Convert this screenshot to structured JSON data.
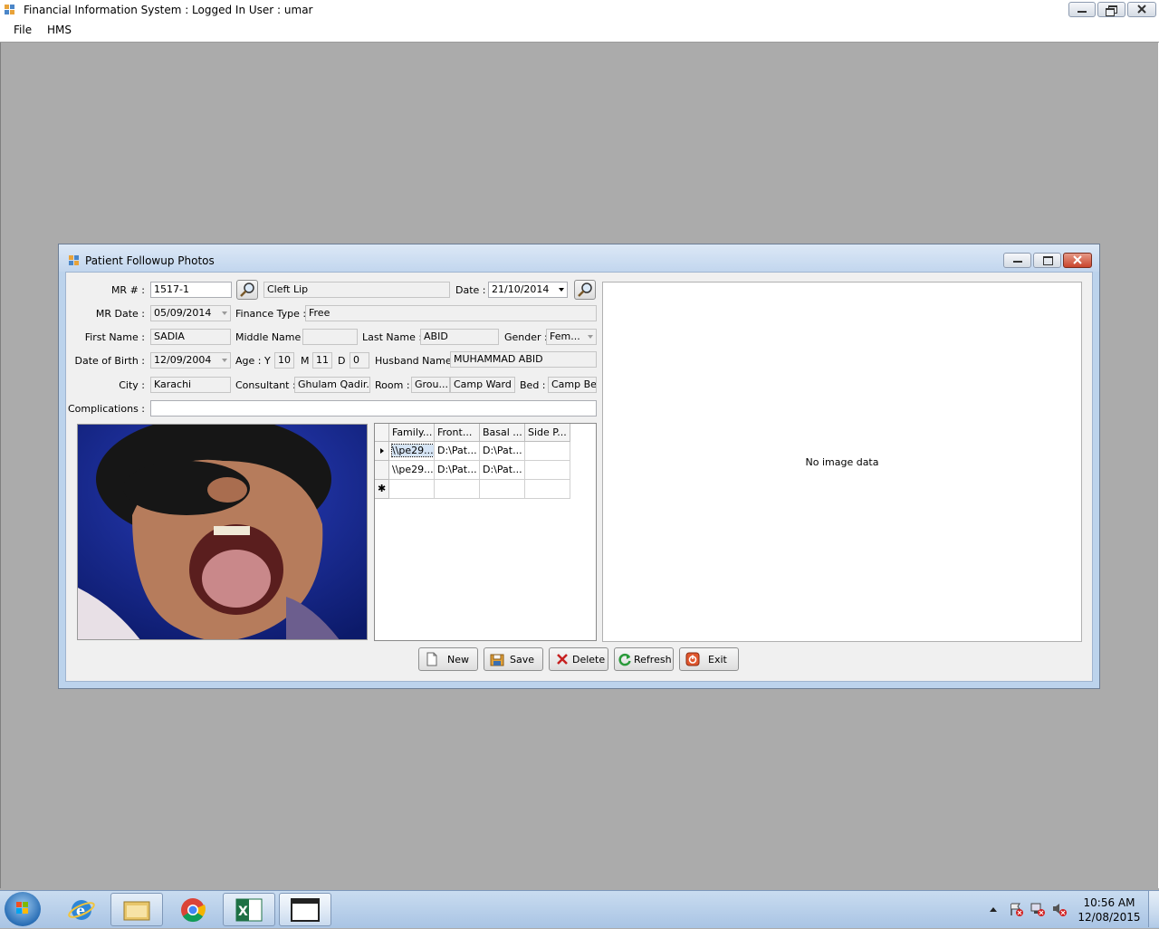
{
  "app": {
    "title": "Financial Information System : Logged In User : umar",
    "menu": [
      "File",
      "HMS"
    ]
  },
  "dialog": {
    "title": "Patient Followup Photos",
    "labels": {
      "mr_no": "MR # :",
      "date": "Date :",
      "mr_date": "MR Date :",
      "finance_type": "Finance Type :",
      "first_name": "First Name :",
      "middle_name": "Middle Name :",
      "last_name": "Last Name :",
      "gender": "Gender :",
      "dob": "Date of Birth :",
      "age": "Age :",
      "age_y": "Y",
      "age_m": "M",
      "age_d": "D",
      "husband_name": "Husband Name :",
      "city": "City :",
      "consultant": "Consultant :",
      "room": "Room :",
      "bed": "Bed :",
      "complications": "Complications :"
    },
    "values": {
      "mr_no": "1517-1",
      "diagnosis": "Cleft Lip",
      "date": "21/10/2014",
      "mr_date": "05/09/2014",
      "finance_type": "Free",
      "first_name": "SADIA",
      "middle_name": "",
      "last_name": "ABID",
      "gender": "Fem...",
      "dob": "12/09/2004",
      "age_y": "10",
      "age_m": "11",
      "age_d": "0",
      "husband_name": "MUHAMMAD ABID",
      "city": "Karachi",
      "consultant": "Ghulam Qadir...",
      "room_type": "Grou...",
      "room": "Camp Ward",
      "bed": "Camp Bed",
      "complications": ""
    },
    "grid": {
      "columns": [
        "Family...",
        "Front...",
        "Basal ...",
        "Side P..."
      ],
      "rows": [
        [
          "\\\\pe29...",
          "D:\\Pat...",
          "D:\\Pat...",
          ""
        ],
        [
          "\\\\pe29...",
          "D:\\Pat...",
          "D:\\Pat...",
          ""
        ]
      ]
    },
    "no_image_text": "No image data",
    "buttons": {
      "new": "New",
      "save": "Save",
      "delete": "Delete",
      "refresh": "Refresh",
      "exit": "Exit"
    }
  },
  "taskbar": {
    "time": "10:56 AM",
    "date": "12/08/2015"
  },
  "colors": {
    "mdi_background": "#ababab",
    "dialog_frame": "#bcd3ec",
    "taskbar": "#b9d1ea"
  }
}
